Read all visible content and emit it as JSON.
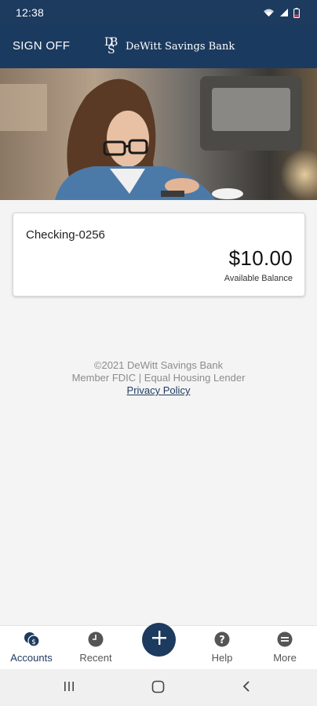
{
  "status_bar": {
    "time": "12:38",
    "icons": [
      "wifi-icon",
      "signal-icon",
      "battery-icon"
    ]
  },
  "header": {
    "sign_off_label": "SIGN OFF",
    "logo_monogram": "DSB",
    "brand_name": "DeWitt Savings Bank",
    "background_color": "#1b3a5f"
  },
  "account": {
    "name": "Checking-0256",
    "balance": "$10.00",
    "balance_label": "Available Balance"
  },
  "legal": {
    "copyright": "©2021 DeWitt Savings Bank",
    "member_line": "Member FDIC | Equal Housing Lender",
    "privacy_label": "Privacy Policy"
  },
  "bottom_nav": {
    "items": [
      {
        "label": "Accounts",
        "icon": "accounts-icon",
        "active": true
      },
      {
        "label": "Recent",
        "icon": "clock-icon",
        "active": false
      },
      {
        "label": "Help",
        "icon": "help-icon",
        "active": false
      },
      {
        "label": "More",
        "icon": "more-icon",
        "active": false
      }
    ],
    "add_icon": "plus-icon"
  },
  "system_nav": {
    "icons": [
      "recent-apps-icon",
      "home-icon",
      "back-icon"
    ]
  },
  "colors": {
    "primary": "#1d3a5f",
    "background": "#f4f4f4",
    "muted_text": "#8c8c8c"
  }
}
